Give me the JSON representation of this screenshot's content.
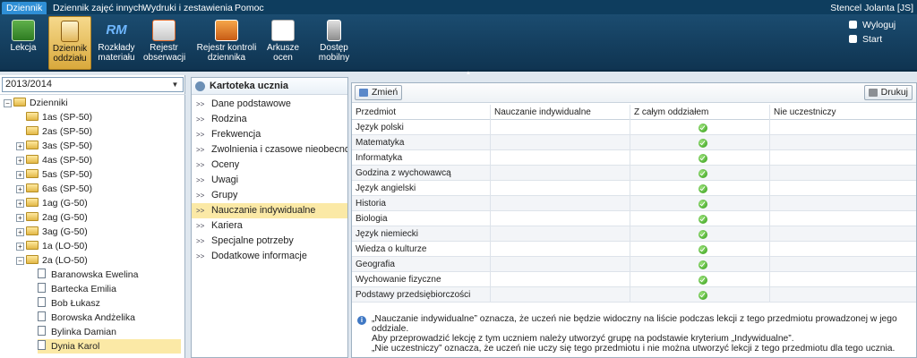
{
  "menu": {
    "tabs": [
      {
        "label": "Dziennik",
        "active": true
      },
      {
        "label": "Dziennik zajęć innych",
        "active": false
      },
      {
        "label": "Wydruki i zestawienia",
        "active": false
      },
      {
        "label": "Pomoc",
        "active": false
      }
    ],
    "user": "Stencel Jolanta [JS]"
  },
  "toolbar": {
    "items": [
      {
        "label": "Lekcja",
        "icon": "lesson-icon"
      },
      {
        "label": "Dziennik oddziału",
        "icon": "class-journal-icon",
        "active": true
      },
      {
        "label": "Rozkłady materiału",
        "icon": "rm-icon"
      },
      {
        "label": "Rejestr obserwacji",
        "icon": "observation-register-icon"
      },
      {
        "label": "Rejestr kontroli dziennika",
        "icon": "journal-control-icon"
      },
      {
        "label": "Arkusze ocen",
        "icon": "grade-sheets-icon"
      },
      {
        "label": "Dostęp mobilny",
        "icon": "mobile-access-icon"
      }
    ],
    "rm_text": "RM",
    "side_links": {
      "logout": "Wyloguj",
      "start": "Start"
    }
  },
  "left": {
    "year": "2013/2014",
    "root": "Dzienniki",
    "classes": [
      "1as (SP-50)",
      "2as (SP-50)",
      "3as (SP-50)",
      "4as (SP-50)",
      "5as (SP-50)",
      "6as (SP-50)",
      "1ag (G-50)",
      "2ag (G-50)",
      "3ag (G-50)",
      "1a (LO-50)",
      "2a (LO-50)"
    ],
    "students": [
      "Baranowska Ewelina",
      "Bartecka Emilia",
      "Bob Łukasz",
      "Borowska Andżelika",
      "Bylinka Damian",
      "Dynia Karol"
    ]
  },
  "middle": {
    "title": "Kartoteka ucznia",
    "items": [
      "Dane podstawowe",
      "Rodzina",
      "Frekwencja",
      "Zwolnienia i czasowe nieobecności",
      "Oceny",
      "Uwagi",
      "Grupy",
      "Nauczanie indywidualne",
      "Kariera",
      "Specjalne potrzeby",
      "Dodatkowe informacje"
    ],
    "active_index": 7
  },
  "right": {
    "edit_button": "Zmień",
    "print_button": "Drukuj",
    "columns": [
      "Przedmiot",
      "Nauczanie indywidualne",
      "Z całym oddziałem",
      "Nie uczestniczy"
    ],
    "rows": [
      "Język polski",
      "Matematyka",
      "Informatyka",
      "Godzina z wychowawcą",
      "Język angielski",
      "Historia",
      "Biologia",
      "Język niemiecki",
      "Wiedza o kulturze",
      "Geografia",
      "Wychowanie fizyczne",
      "Podstawy przedsiębiorczości"
    ],
    "check_column": "Z całym oddziałem",
    "info": [
      "„Nauczanie indywidualne” oznacza, że uczeń nie będzie widoczny na liście podczas lekcji z tego przedmiotu prowadzonej w jego oddziale.",
      "Aby przeprowadzić lekcję z tym uczniem należy utworzyć grupę na podstawie kryterium „Indywidualne”.",
      "„Nie uczestniczy” oznacza, że uczeń nie uczy się tego przedmiotu i nie można utworzyć lekcji z tego przedmiotu dla tego ucznia."
    ],
    "info_icon": "i"
  },
  "colors": {
    "menubar": "#0e3d5e",
    "active_tab": "#2f8fd6",
    "active_item": "#fbe9a6",
    "check": "#2f9b13"
  }
}
